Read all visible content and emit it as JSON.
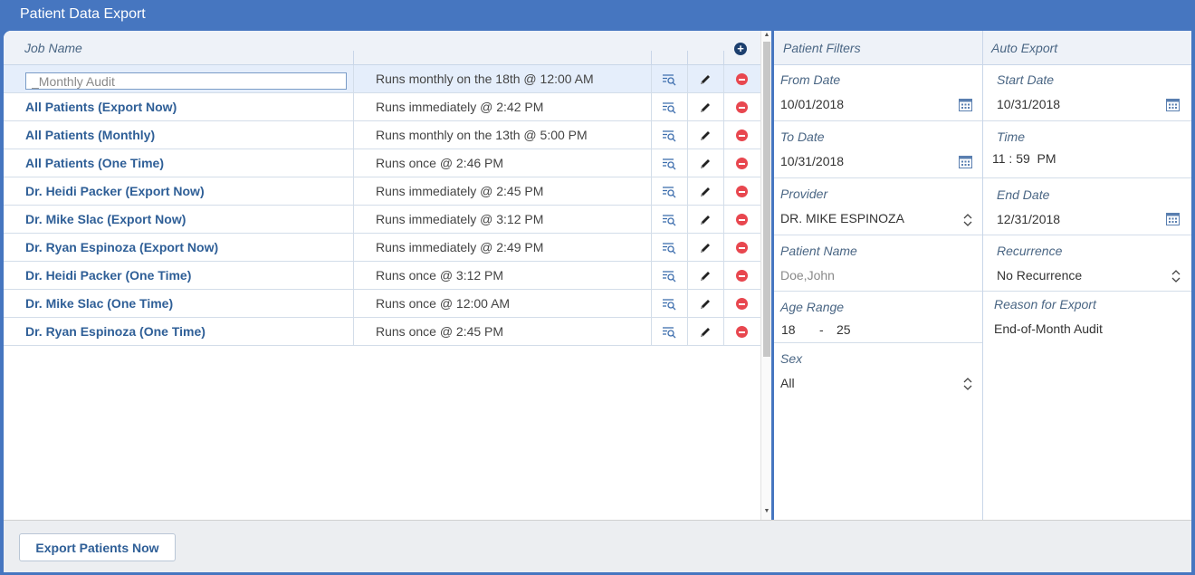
{
  "window": {
    "title": "Patient Data Export"
  },
  "grid": {
    "column_job_name": "Job Name",
    "rows": [
      {
        "name": "_Monthly Audit",
        "schedule": "Runs monthly on the 18th @ 12:00 AM",
        "editing": true
      },
      {
        "name": "All Patients (Export Now)",
        "schedule": "Runs immediately @ 2:42 PM"
      },
      {
        "name": "All Patients (Monthly)",
        "schedule": "Runs monthly on the 13th @ 5:00 PM"
      },
      {
        "name": "All Patients (One Time)",
        "schedule": "Runs once @ 2:46 PM"
      },
      {
        "name": "Dr. Heidi Packer (Export Now)",
        "schedule": "Runs immediately  @ 2:45 PM"
      },
      {
        "name": "Dr. Mike Slac (Export Now)",
        "schedule": "Runs immediately  @ 3:12 PM"
      },
      {
        "name": "Dr. Ryan Espinoza (Export Now)",
        "schedule": "Runs immediately  @ 2:49 PM"
      },
      {
        "name": "Dr. Heidi Packer  (One Time)",
        "schedule": "Runs  once @ 3:12 PM"
      },
      {
        "name": "Dr. Mike Slac  (One Time)",
        "schedule": "Runs once @ 12:00 AM"
      },
      {
        "name": "Dr. Ryan Espinoza  (One Time)",
        "schedule": "Runs once @ 2:45 PM"
      }
    ]
  },
  "patient_filters": {
    "title": "Patient Filters",
    "from_date_label": "From Date",
    "from_date": "10/01/2018",
    "to_date_label": "To Date",
    "to_date": "10/31/2018",
    "provider_label": "Provider",
    "provider": "DR. MIKE ESPINOZA",
    "patient_name_label": "Patient Name",
    "patient_name_placeholder": "Doe,John",
    "age_range_label": "Age Range",
    "age_min": "18",
    "age_dash": "-",
    "age_max": "25",
    "sex_label": "Sex",
    "sex": "All"
  },
  "auto_export": {
    "title": "Auto Export",
    "start_date_label": "Start Date",
    "start_date": "10/31/2018",
    "time_label": "Time",
    "time": "11 : 59  PM",
    "end_date_label": "End Date",
    "end_date": "12/31/2018",
    "recurrence_label": "Recurrence",
    "recurrence": "No Recurrence",
    "reason_label": "Reason for Export",
    "reason": "End-of-Month Audit"
  },
  "footer": {
    "export_button": "Export Patients Now"
  },
  "colors": {
    "accent": "#4676c0",
    "link": "#2f5f97",
    "delete": "#e8474f",
    "selected_row": "#e5eefb"
  }
}
